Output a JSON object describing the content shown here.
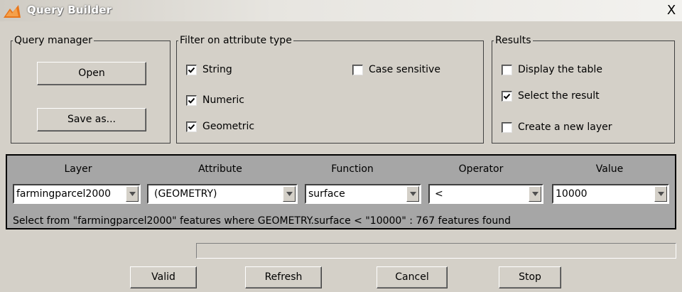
{
  "window": {
    "title": "Query Builder",
    "close_glyph": "X",
    "icon": "app-logo-icon"
  },
  "query_manager": {
    "legend": "Query manager",
    "open_label": "Open",
    "save_as_label": "Save as..."
  },
  "filter": {
    "legend": "Filter on attribute type",
    "items": [
      {
        "label": "String",
        "checked": true
      },
      {
        "label": "Numeric",
        "checked": true
      },
      {
        "label": "Geometric",
        "checked": true
      }
    ],
    "case_sensitive": {
      "label": "Case sensitive",
      "checked": false
    }
  },
  "results": {
    "legend": "Results",
    "items": [
      {
        "label": "Display the table",
        "checked": false
      },
      {
        "label": "Select the result",
        "checked": true
      },
      {
        "label": "Create a new layer",
        "checked": false
      }
    ]
  },
  "query": {
    "columns": [
      "Layer",
      "Attribute",
      "Function",
      "Operator",
      "Value"
    ],
    "values": [
      "farmingparcel2000",
      "(GEOMETRY)",
      "surface",
      "<",
      "10000"
    ],
    "status": "Select from \"farmingparcel2000\" features where GEOMETRY.surface < \"10000\" : 767 features found"
  },
  "buttons": {
    "valid": "Valid",
    "refresh": "Refresh",
    "cancel": "Cancel",
    "stop": "Stop"
  },
  "colors": {
    "panel_bg": "#d4d0c8",
    "query_panel_bg": "#a6a6a6"
  }
}
